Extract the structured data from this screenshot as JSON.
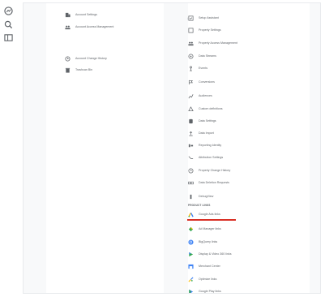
{
  "rail": {
    "icons": [
      "analytics-icon",
      "search-icon",
      "dashboard-icon"
    ]
  },
  "left_column": {
    "items": [
      {
        "label": "Account Settings",
        "icon": "building-icon"
      },
      {
        "label": "Account Access Management",
        "icon": "people-icon"
      },
      {
        "label": "Account Change History",
        "icon": "history-icon"
      },
      {
        "label": "Trashcan Bin",
        "icon": "trash-icon"
      }
    ]
  },
  "right_column": {
    "items": [
      {
        "label": "Setup Assistant",
        "icon": "checklist-icon"
      },
      {
        "label": "Property Settings",
        "icon": "property-icon"
      },
      {
        "label": "Property Access Management",
        "icon": "people-icon"
      },
      {
        "label": "Data Streams",
        "icon": "streams-icon"
      },
      {
        "label": "Events",
        "icon": "touch-icon"
      },
      {
        "label": "Conversions",
        "icon": "flag-icon"
      },
      {
        "label": "Audiences",
        "icon": "audience-icon"
      },
      {
        "label": "Custom definitions",
        "icon": "custom-definitions-icon"
      },
      {
        "label": "Data Settings",
        "icon": "database-icon"
      },
      {
        "label": "Data Import",
        "icon": "upload-icon"
      },
      {
        "label": "Reporting Identity",
        "icon": "identity-icon"
      },
      {
        "label": "Attribution Settings",
        "icon": "attribution-icon"
      },
      {
        "label": "Property Change History",
        "icon": "history-icon"
      },
      {
        "label": "Data Deletion Requests",
        "icon": "dd-icon"
      },
      {
        "label": "DebugView",
        "icon": "debug-icon"
      }
    ],
    "product_links_title": "PRODUCT LINKS",
    "product_links": [
      {
        "label": "Google Ads links",
        "icon": "google-ads-icon"
      },
      {
        "label": "Ad Manager links",
        "icon": "ad-manager-icon"
      },
      {
        "label": "BigQuery links",
        "icon": "bigquery-icon"
      },
      {
        "label": "Display & Video 360 links",
        "icon": "display-video-icon"
      },
      {
        "label": "Merchant Center",
        "icon": "merchant-center-icon"
      },
      {
        "label": "Optimize links",
        "icon": "optimize-icon"
      },
      {
        "label": "Google Play links",
        "icon": "google-play-icon"
      }
    ]
  },
  "colors": {
    "highlight_underline": "#d93025",
    "text": "#5f6368",
    "google_blue": "#4285f4",
    "google_green": "#34a853",
    "google_yellow": "#fbbc04"
  }
}
